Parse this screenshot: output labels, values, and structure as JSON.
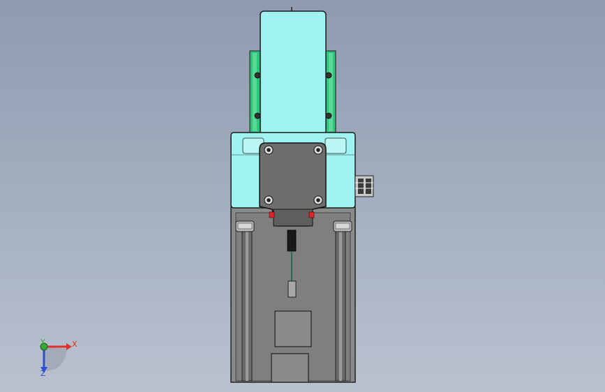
{
  "viewport": {
    "background_top": "#8e9bb0",
    "background_bottom": "#b9c2cf"
  },
  "model": {
    "colors": {
      "cyan_body": "#9ff3f0",
      "green_rail": "#2ec47a",
      "grey_base": "#8a8a88",
      "dark_plate": "#6a6a68",
      "red_seal": "#d8262a"
    }
  },
  "triad": {
    "x_label": "X",
    "y_label": "Y",
    "z_label": "Z",
    "x_color": "#e0302a",
    "y_color": "#37a837",
    "z_color": "#2a4fd0"
  }
}
